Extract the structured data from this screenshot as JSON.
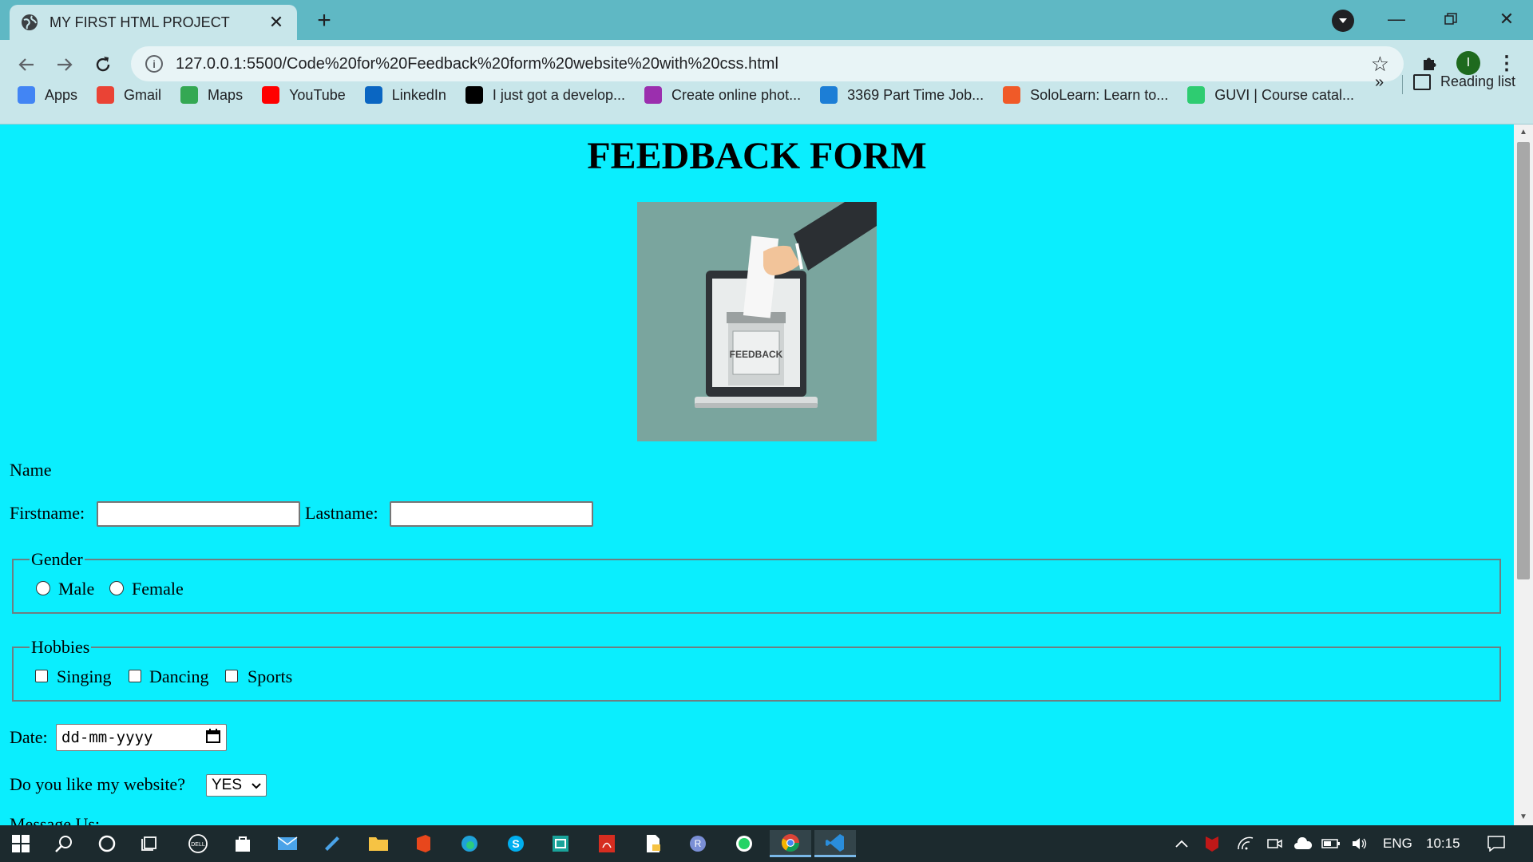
{
  "browser": {
    "tab_title": "MY FIRST HTML PROJECT",
    "url": "127.0.0.1:5500/Code%20for%20Feedback%20form%20website%20with%20css.html",
    "profile_initial": "I",
    "bookmarks": [
      {
        "label": "Apps",
        "icon": "apps-grid-icon",
        "color": "#4285f4"
      },
      {
        "label": "Gmail",
        "icon": "gmail-icon",
        "color": "#ea4335"
      },
      {
        "label": "Maps",
        "icon": "maps-icon",
        "color": "#34a853"
      },
      {
        "label": "YouTube",
        "icon": "youtube-icon",
        "color": "#ff0000"
      },
      {
        "label": "LinkedIn",
        "icon": "linkedin-icon",
        "color": "#0a66c2"
      },
      {
        "label": "I just got a develop...",
        "icon": "medium-icon",
        "color": "#000000"
      },
      {
        "label": "Create online phot...",
        "icon": "collage-icon",
        "color": "#9b2fae"
      },
      {
        "label": "3369 Part Time Job...",
        "icon": "indeed-icon",
        "color": "#1c7ed6"
      },
      {
        "label": "SoloLearn: Learn to...",
        "icon": "sololearn-icon",
        "color": "#f05a28"
      },
      {
        "label": "GUVI | Course catal...",
        "icon": "guvi-icon",
        "color": "#2ecc71"
      }
    ],
    "bookmarks_more": "»",
    "reading_list": "Reading list"
  },
  "page": {
    "title": "FEEDBACK FORM",
    "image_text": "FEEDBACK",
    "name_label": "Name",
    "firstname_label": "Firstname:",
    "lastname_label": "Lastname:",
    "gender_legend": "Gender",
    "gender_options": [
      "Male",
      "Female"
    ],
    "hobbies_legend": "Hobbies",
    "hobbies_options": [
      "Singing",
      "Dancing",
      "Sports"
    ],
    "date_label": "Date:",
    "date_placeholder": "dd-mm-yyyy",
    "question_label": "Do you like my website?",
    "question_value": "YES",
    "message_label": "Message Us:"
  },
  "taskbar": {
    "language": "ENG",
    "time": "10:15"
  }
}
